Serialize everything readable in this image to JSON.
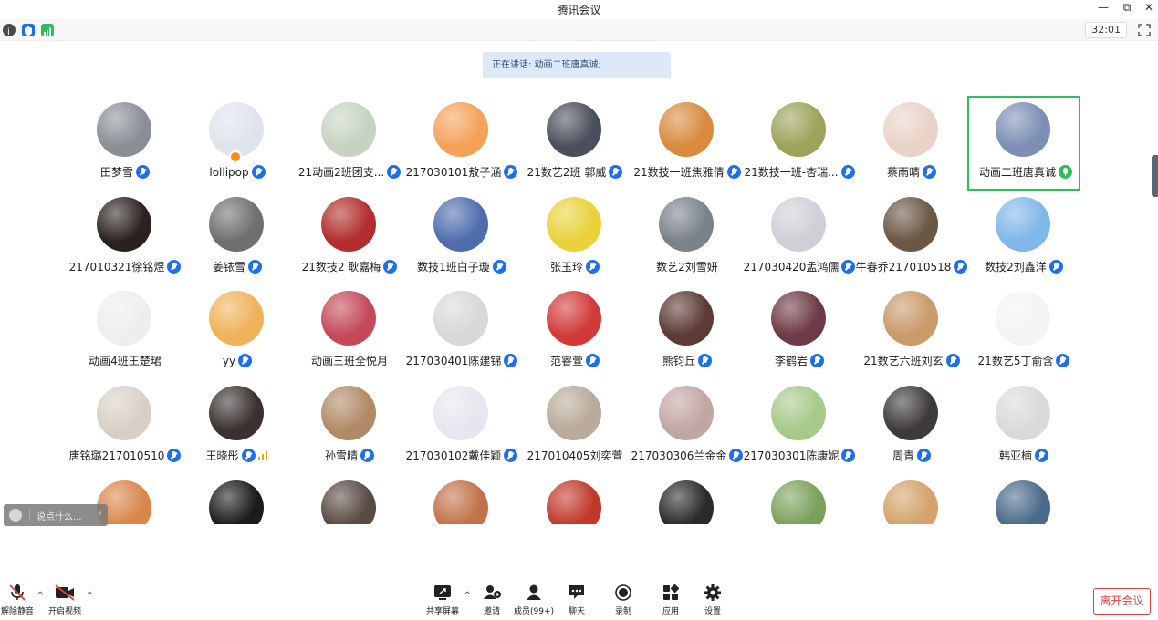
{
  "window": {
    "title": "腾讯会议",
    "controls": [
      "minimize-icon",
      "restore-icon",
      "close-icon"
    ]
  },
  "toolbar": {
    "icons": [
      "info-icon",
      "shield-icon",
      "signal-icon"
    ],
    "timer": "32:01"
  },
  "speaking": {
    "text": "正在讲话: 动画二班唐真诚;"
  },
  "participants": [
    {
      "name": "田梦雪",
      "mic": "muted",
      "color": "#8a8f96"
    },
    {
      "name": "lollipop",
      "mic": "muted",
      "color": "#dfe4ec",
      "host": true
    },
    {
      "name": "21动画2班团支...",
      "mic": "muted",
      "color": "#c6d3c2"
    },
    {
      "name": "217030101敖子涵",
      "mic": "muted",
      "color": "#f4a25a"
    },
    {
      "name": "21数艺2班 郭威",
      "mic": "muted",
      "color": "#4b4f5c"
    },
    {
      "name": "21数技一班焦雅倩",
      "mic": "muted",
      "color": "#d98a3c"
    },
    {
      "name": "21数技一班-杏瑞...",
      "mic": "muted",
      "color": "#9ca35a"
    },
    {
      "name": "蔡雨晴",
      "mic": "muted",
      "color": "#e9d3c8"
    },
    {
      "name": "动画二班唐真诚",
      "mic": "speaking",
      "color": "#7d8fb6",
      "active": true
    },
    {
      "name": "217010321徐铭煜",
      "mic": "muted",
      "color": "#2b2220"
    },
    {
      "name": "姜铱雪",
      "mic": "muted",
      "color": "#6f6f6f"
    },
    {
      "name": "21数技2 耿嘉梅",
      "mic": "muted",
      "color": "#b22e2e"
    },
    {
      "name": "数技1班白子璇",
      "mic": "muted",
      "color": "#4f6dae"
    },
    {
      "name": "张玉玲",
      "mic": "muted",
      "color": "#e9d23a"
    },
    {
      "name": "数艺2刘雪妍",
      "mic": "none",
      "color": "#7a828a"
    },
    {
      "name": "217030420孟鸿儒",
      "mic": "muted",
      "color": "#cfcfd6"
    },
    {
      "name": "牛春乔217010518",
      "mic": "muted",
      "color": "#6a5744"
    },
    {
      "name": "数技2刘鑫洋",
      "mic": "muted",
      "color": "#7fb7e8"
    },
    {
      "name": "动画4班王楚珺",
      "mic": "none",
      "color": "#eeeeee"
    },
    {
      "name": "yy",
      "mic": "muted",
      "color": "#f0b25a"
    },
    {
      "name": "动画三班全悦月",
      "mic": "none",
      "color": "#c44a5a"
    },
    {
      "name": "217030401陈建锦",
      "mic": "muted",
      "color": "#d8d8d8"
    },
    {
      "name": "范睿萱",
      "mic": "muted",
      "color": "#d23a3a"
    },
    {
      "name": "熊钧丘",
      "mic": "muted",
      "color": "#5c3b34"
    },
    {
      "name": "李鹤岩",
      "mic": "muted",
      "color": "#6e3a45"
    },
    {
      "name": "21数艺六班刘玄",
      "mic": "muted",
      "color": "#c99a6a"
    },
    {
      "name": "21数艺5丁俞含",
      "mic": "muted",
      "color": "#f4f4f4"
    },
    {
      "name": "唐铭璐217010510",
      "mic": "muted",
      "color": "#d9cfc6"
    },
    {
      "name": "王晓彤",
      "mic": "muted",
      "color": "#3a3230",
      "signal": true
    },
    {
      "name": "孙雪晴",
      "mic": "muted",
      "color": "#b08a66"
    },
    {
      "name": "217030102戴佳颖",
      "mic": "muted",
      "color": "#e6e6ee"
    },
    {
      "name": "217010405刘奕萱",
      "mic": "none",
      "color": "#b9aa9a"
    },
    {
      "name": "217030306兰金金",
      "mic": "muted",
      "color": "#c2a6a2"
    },
    {
      "name": "217030301陈康妮",
      "mic": "muted",
      "color": "#a7c98a"
    },
    {
      "name": "周青",
      "mic": "muted",
      "color": "#3e3a3a"
    },
    {
      "name": "韩亚楠",
      "mic": "muted",
      "color": "#dadada"
    },
    {
      "name": "",
      "mic": "none",
      "color": "#d8864a"
    },
    {
      "name": "",
      "mic": "none",
      "color": "#1b1b1b"
    },
    {
      "name": "",
      "mic": "none",
      "color": "#5a4a44"
    },
    {
      "name": "",
      "mic": "none",
      "color": "#c2724a"
    },
    {
      "name": "",
      "mic": "none",
      "color": "#c0392b"
    },
    {
      "name": "",
      "mic": "none",
      "color": "#2a2a2a"
    },
    {
      "name": "",
      "mic": "none",
      "color": "#7ba05b"
    },
    {
      "name": "",
      "mic": "none",
      "color": "#d4a26a"
    },
    {
      "name": "",
      "mic": "none",
      "color": "#4a6a8a"
    }
  ],
  "chat": {
    "placeholder": "说点什么..."
  },
  "bottom": {
    "unmute": "解除静音",
    "video": "开启视频",
    "share": "共享屏幕",
    "invite": "邀请",
    "members": "成员(99+)",
    "chat": "聊天",
    "record": "录制",
    "apps": "应用",
    "settings": "设置",
    "leave": "离开会议"
  },
  "colors": {
    "accent": "#1d6ff2",
    "speaking_border": "#2fbf5a",
    "leave": "#e0413a"
  }
}
